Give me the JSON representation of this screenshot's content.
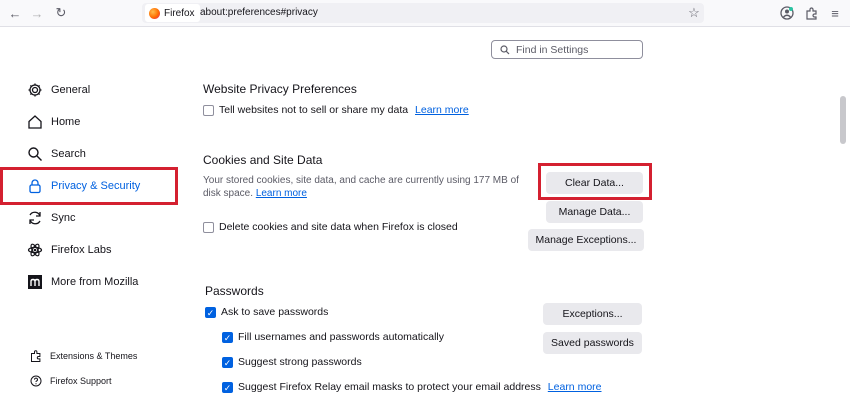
{
  "toolbar": {
    "identity_label": "Firefox",
    "url": "about:preferences#privacy"
  },
  "search": {
    "placeholder": "Find in Settings"
  },
  "sidebar": {
    "items": [
      {
        "label": "General"
      },
      {
        "label": "Home"
      },
      {
        "label": "Search"
      },
      {
        "label": "Privacy & Security"
      },
      {
        "label": "Sync"
      },
      {
        "label": "Firefox Labs"
      },
      {
        "label": "More from Mozilla"
      }
    ],
    "footer": [
      {
        "label": "Extensions & Themes"
      },
      {
        "label": "Firefox Support"
      }
    ]
  },
  "website_privacy": {
    "heading": "Website Privacy Preferences",
    "checkbox_label": "Tell websites not to sell or share my data",
    "learn_more": "Learn more"
  },
  "cookies": {
    "heading": "Cookies and Site Data",
    "desc_line1": "Your stored cookies, site data, and cache are currently using 177 MB of",
    "desc_line2": "disk space.",
    "learn_more": "Learn more",
    "delete_label": "Delete cookies and site data when Firefox is closed",
    "clear_button": "Clear Data...",
    "manage_button": "Manage Data...",
    "exceptions_button": "Manage Exceptions..."
  },
  "passwords": {
    "heading": "Passwords",
    "ask_label": "Ask to save passwords",
    "fill_label": "Fill usernames and passwords automatically",
    "suggest_label": "Suggest strong passwords",
    "relay_label": "Suggest Firefox Relay email masks to protect your email address",
    "relay_learn_more": "Learn more",
    "exceptions_button": "Exceptions...",
    "saved_button": "Saved passwords"
  }
}
